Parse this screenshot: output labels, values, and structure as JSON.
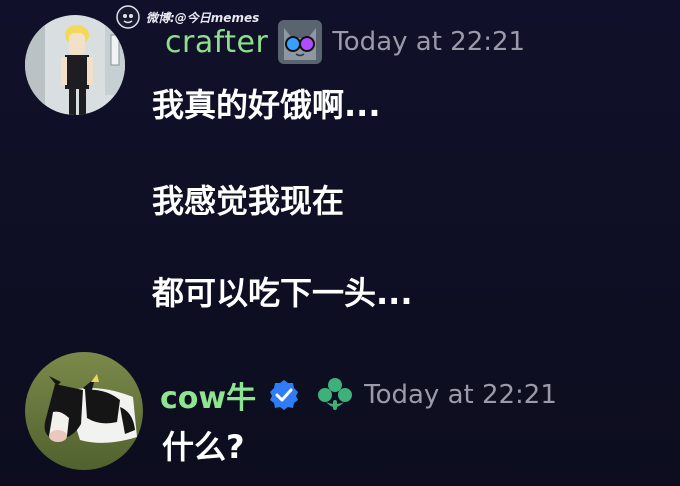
{
  "watermark": {
    "text": "微博:@今日memes"
  },
  "messages": [
    {
      "author": "crafter",
      "timestamp": "Today at 22:21",
      "lines": [
        "我真的好饿啊...",
        "我感觉我现在",
        "都可以吃下一头..."
      ],
      "avatar_icon": "cartoon-character-avatar",
      "badge_icon": "cat-with-glasses-icon"
    },
    {
      "author": "cow牛",
      "timestamp": "Today at 22:21",
      "lines": [
        "什么?"
      ],
      "avatar_icon": "cow-avatar",
      "badge_icons": [
        "verified-check-icon",
        "clover-icon"
      ]
    }
  ],
  "colors": {
    "background": "#0e0e22",
    "username_green": "#8fe08a",
    "verified_blue": "#3b82f6",
    "clover_green": "#3fb07a",
    "timestamp_gray": "#9a9aa8",
    "message_text": "#ffffff"
  }
}
